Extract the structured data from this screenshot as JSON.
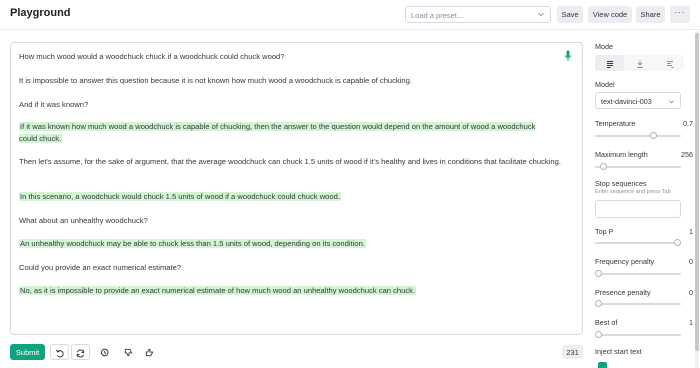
{
  "header": {
    "title": "Playground",
    "preset_placeholder": "Load a preset...",
    "save_label": "Save",
    "view_code_label": "View code",
    "share_label": "Share",
    "more_label": "···"
  },
  "editor": {
    "paragraphs": [
      {
        "text": "How much wood would a woodchuck chuck if a woodchuck could chuck wood?",
        "generated": false
      },
      {
        "text": "It is impossible to answer this question because it is not known how much wood a woodchuck is capable of chucking.",
        "generated": false
      },
      {
        "text": "And if it was known?",
        "generated": false
      },
      {
        "text": "If it was known how much wood a woodchuck is capable of chucking, then the answer to the question would depend on the amount of wood a woodchuck could chuck.",
        "generated": true
      },
      {
        "text": "Then let's assume, for the sake of argument, that the average woodchuck can chuck 1.5 units of wood if it's healthy and lives in conditions that facilitate chucking.",
        "generated": false
      },
      {
        "text": "In this scenario, a woodchuck would chuck 1.5 units of wood if a woodchuck could chuck wood.",
        "generated": true
      },
      {
        "text": "What about an unhealthy woodchuck?",
        "generated": false
      },
      {
        "text": "An unhealthy woodchuck may be able to chuck less than 1.5 units of wood, depending on its condition.",
        "generated": true
      },
      {
        "text": "Could you provide an exact numerical estimate?",
        "generated": false
      },
      {
        "text": "No, as it is impossible to provide an exact numerical estimate of how much wood an unhealthy woodchuck can chuck.",
        "generated": true
      }
    ],
    "highlight_color": "#d2f4d3"
  },
  "footer": {
    "submit_label": "Submit",
    "token_count": "231",
    "accent_color": "#10a37f",
    "icons": [
      "undo-icon",
      "regenerate-icon",
      "history-icon",
      "thumbs-down-icon",
      "thumbs-up-icon"
    ]
  },
  "sidebar": {
    "mode_label": "Mode",
    "modes": [
      "complete-mode-icon",
      "insert-mode-icon",
      "edit-mode-icon"
    ],
    "active_mode": 0,
    "model_label": "Model",
    "model_value": "text-davinci-003",
    "temperature": {
      "label": "Temperature",
      "value": "0.7",
      "fraction": 0.7
    },
    "max_length": {
      "label": "Maximum length",
      "value": "256",
      "fraction": 0.06
    },
    "stop_sequences": {
      "label": "Stop sequences",
      "hint": "Enter sequence and press Tab"
    },
    "top_p": {
      "label": "Top P",
      "value": "1",
      "fraction": 1.0
    },
    "frequency_penalty": {
      "label": "Frequency penalty",
      "value": "0",
      "fraction": 0.0
    },
    "presence_penalty": {
      "label": "Presence penalty",
      "value": "0",
      "fraction": 0.0
    },
    "best_of": {
      "label": "Best of",
      "value": "1",
      "fraction": 0.0
    },
    "inject_start_text": {
      "label": "Inject start text",
      "checked": true
    }
  }
}
